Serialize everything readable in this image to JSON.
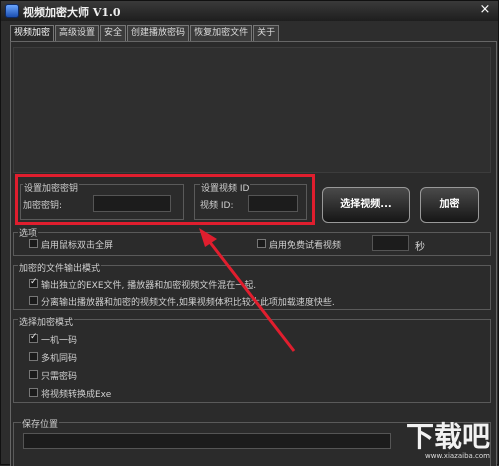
{
  "window": {
    "title": "视频加密大师 V1.0",
    "close_symbol": "×"
  },
  "tabs": [
    {
      "label": "视频加密",
      "active": true
    },
    {
      "label": "高级设置"
    },
    {
      "label": "安全"
    },
    {
      "label": "创建播放密码"
    },
    {
      "label": "恢复加密文件"
    },
    {
      "label": "关于"
    }
  ],
  "key_group": {
    "title": "设置加密密钥",
    "field_label": "加密密钥:",
    "value": ""
  },
  "id_group": {
    "title": "设置视频 ID",
    "field_label": "视频 ID:",
    "value": ""
  },
  "buttons": {
    "select_video": "选择视频...",
    "encrypt": "加密"
  },
  "options": {
    "title": "选项",
    "fullscreen_label": "启用鼠标双击全屏",
    "fullscreen_checked": false,
    "trial_label": "启用免费试看视频",
    "trial_checked": false,
    "trial_value": "",
    "seconds_unit": "秒"
  },
  "output_mode": {
    "title": "加密的文件输出模式",
    "items": [
      {
        "label": "输出独立的EXE文件, 播放器和加密视频文件混在一起.",
        "checked": true
      },
      {
        "label": "分离输出播放器和加密的视频文件,如果视频体积比较大此项加载速度快些.",
        "checked": false
      }
    ]
  },
  "encrypt_mode": {
    "title": "选择加密模式",
    "items": [
      {
        "label": "一机一码",
        "checked": true
      },
      {
        "label": "多机同码",
        "checked": false
      },
      {
        "label": "只需密码",
        "checked": false
      },
      {
        "label": "将视频转换成Exe",
        "checked": false
      }
    ]
  },
  "save": {
    "title": "保存位置",
    "path": ""
  },
  "watermark": {
    "main": "下载吧",
    "sub": "www.xiazaiba.com"
  },
  "colors": {
    "highlight": "#e01e2e",
    "background": "#2b2b2b"
  }
}
